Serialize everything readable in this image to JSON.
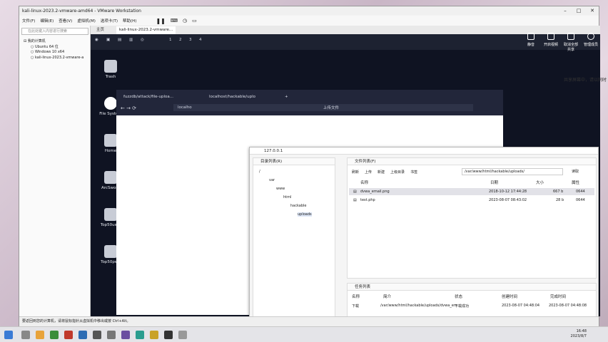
{
  "vmware": {
    "title": "kali-linux-2023.2-vmware-amd64 - VMware Workstation",
    "menu": [
      "文件(F)",
      "编辑(E)",
      "查看(V)",
      "虚拟机(M)",
      "选项卡(T)",
      "帮助(H)"
    ],
    "library": {
      "search_placeholder": "在此处键入内容进行搜索",
      "root": "我的计算机",
      "items": [
        "Ubuntu 64 位",
        "Windows 10 x64",
        "kali-linux-2023.2-vmware-a"
      ]
    },
    "tabs": [
      {
        "label": "主页"
      },
      {
        "label": "kali-linux-2023.2-vmware..."
      }
    ],
    "status": "要返回到您的计算机，请将鼠标指针从虚拟机中移出或按 Ctrl+Alt。",
    "workspaces": [
      "1",
      "2",
      "3",
      "4"
    ]
  },
  "kali": {
    "desktop_icons": [
      "Trash",
      "File System",
      "Home",
      "ArcSword",
      "Top50user",
      "Top50pwd"
    ],
    "firefox": {
      "tabs": [
        "fuzzdb/attack/file-uploa...",
        "localhost/hackable/uplo"
      ],
      "url": "localho",
      "page_title": "上传文件"
    }
  },
  "filemanager": {
    "title": "127.0.0.1",
    "local_pane_title": "目录列表(R)",
    "right_pane_title": "文件列表(F)",
    "toolbar": [
      "刷新",
      "上传",
      "新建",
      "上级目录",
      "书签"
    ],
    "path": "/var/www/html/hackable/uploads/",
    "go_label": "读取",
    "columns": [
      "名称",
      "日期",
      "大小",
      "属性"
    ],
    "files": [
      {
        "name": "dvwa_email.png",
        "date": "2018-10-12 17:44:28",
        "size": "667 b",
        "perm": "0644"
      },
      {
        "name": "test.php",
        "date": "2023-08-07 08:43:02",
        "size": "28 b",
        "perm": "0644"
      }
    ],
    "tree": [
      "/",
      "var",
      "www",
      "html",
      "hackable",
      "uploads"
    ],
    "task_title": "任务列表",
    "task_columns": [
      "名称",
      "简介",
      "状态",
      "创建时间",
      "完成时间"
    ],
    "tasks": [
      {
        "name": "下载",
        "desc": "/var/www/html/hackable/uploads/dvwa_em",
        "status": "下载成功",
        "created": "2023-08-07 04:48:04",
        "finished": "2023-08-07 04:48:08"
      }
    ]
  },
  "meeting": {
    "buttons": [
      "静音",
      "开启视频",
      "取消全部共享",
      "管理成员"
    ],
    "share_note": "共享屏幕中，请以同时"
  },
  "taskbar": {
    "time": "16:48",
    "date": "2023/8/7"
  }
}
